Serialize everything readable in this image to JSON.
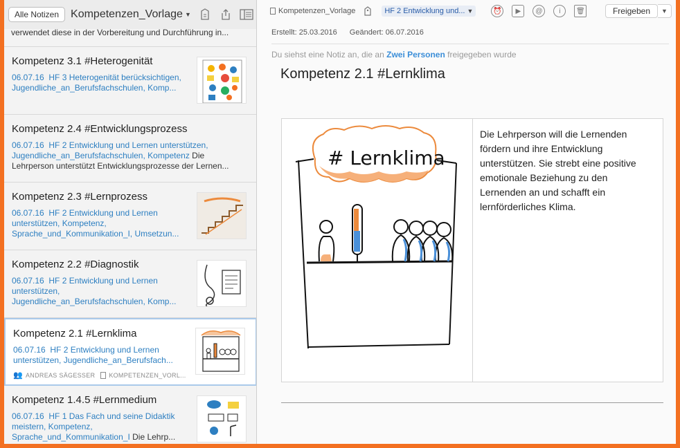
{
  "left_toolbar": {
    "all_notes_label": "Alle Notizen",
    "notebook_title": "Kompetenzen_Vorlage"
  },
  "top_snippet": "verwendet diese in der Vorbereitung und Durchführung in...",
  "notes": [
    {
      "title": "Kompetenz 3.1 #Heterogenität",
      "date": "06.07.16",
      "tags": "HF 3 Heterogenität berücksichtigen, Jugendliche_an_Berufsfachschulen, Komp...",
      "snippet": ""
    },
    {
      "title": "Kompetenz 2.4 #Entwicklungsprozess",
      "date": "06.07.16",
      "tags": "HF 2 Entwicklung und Lernen unterstützen, Jugendliche_an_Berufsfachschulen, Kompetenz",
      "snippet": " Die Lehrperson unterstützt Entwicklungsprozesse der Lernen..."
    },
    {
      "title": "Kompetenz 2.3 #Lernprozess",
      "date": "06.07.16",
      "tags": "HF 2 Entwicklung und Lernen unterstützen, Kompetenz, Sprache_und_Kommunikation_I, Umsetzun...",
      "snippet": ""
    },
    {
      "title": "Kompetenz 2.2 #Diagnostik",
      "date": "06.07.16",
      "tags": "HF 2 Entwicklung und Lernen unterstützen, Jugendliche_an_Berufsfachschulen, Komp...",
      "snippet": ""
    },
    {
      "title": "Kompetenz 2.1 #Lernklima",
      "date": "06.07.16",
      "tags": "HF 2 Entwicklung und Lernen unterstützen, Jugendliche_an_Berufsfach...",
      "snippet": "",
      "author": "ANDREAS SÄGESSER",
      "notebook": "KOMPETENZEN_VORL..."
    },
    {
      "title": "Kompetenz 1.4.5 #Lernmedium",
      "date": "06.07.16",
      "tags": "HF 1 Das Fach und seine Didaktik meistern, Kompetenz, Sprache_und_Kommunikation_I",
      "snippet": " Die Lehrp..."
    }
  ],
  "right_toolbar": {
    "notebook": "Kompetenzen_Vorlage",
    "tag": "HF 2 Entwicklung und...",
    "share_label": "Freigeben"
  },
  "meta": {
    "created": "Erstellt: 25.03.2016",
    "modified": "Geändert: 06.07.2016"
  },
  "shared_info": {
    "prefix": "Du siehst eine Notiz an, die an ",
    "people": "Zwei Personen",
    "suffix": " freigegeben wurde"
  },
  "document": {
    "title": "Kompetenz 2.1 #Lernklima",
    "sketch_heading": "# Lernklima",
    "body": "Die Lehrperson will die Lernenden fördern und ihre Entwicklung unterstützen. Sie strebt eine positive emotionale Beziehung zu den Lernenden an und schafft ein lernförderliches Klima."
  },
  "colors": {
    "accent": "#2d7fc1",
    "frame": "#f37021",
    "sketch_orange": "#ec8a3c",
    "sketch_blue": "#4a90d9"
  }
}
